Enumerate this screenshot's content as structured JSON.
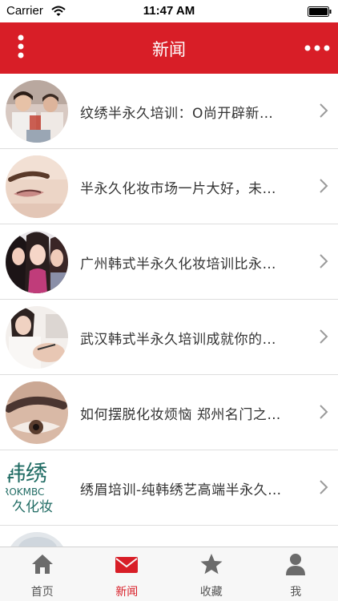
{
  "status_bar": {
    "carrier": "Carrier",
    "time": "11:47 AM"
  },
  "nav": {
    "title": "新闻",
    "left_icon": "vertical-dots-icon",
    "right_icon": "horizontal-dots-icon"
  },
  "news": [
    {
      "title": "纹绣半永久培训：O尚开辟新…",
      "thumb": "classroom-photo"
    },
    {
      "title": "半永久化妆市场一片大好，未…",
      "thumb": "eyebrow-closeup-photo"
    },
    {
      "title": "广州韩式半永久化妆培训比永…",
      "thumb": "models-photo"
    },
    {
      "title": "武汉韩式半永久培训成就你的…",
      "thumb": "technician-photo"
    },
    {
      "title": "如何摆脱化妆烦恼 郑州名门之…",
      "thumb": "brow-tattoo-photo"
    },
    {
      "title": "绣眉培训-纯韩绣艺高端半永久…",
      "thumb": "logo-photo",
      "thumb_text": {
        "line1": "韩绣",
        "line2": "ROKMBC",
        "line3": "久化妆"
      }
    },
    {
      "title": "",
      "thumb": "partial-photo"
    }
  ],
  "tabs": [
    {
      "label": "首页",
      "icon": "home-icon",
      "active": false
    },
    {
      "label": "新闻",
      "icon": "mail-icon",
      "active": true
    },
    {
      "label": "收藏",
      "icon": "star-icon",
      "active": false
    },
    {
      "label": "我",
      "icon": "person-icon",
      "active": false
    }
  ],
  "colors": {
    "accent": "#d81e27",
    "tab_inactive": "#555555",
    "background": "#ffffff"
  }
}
